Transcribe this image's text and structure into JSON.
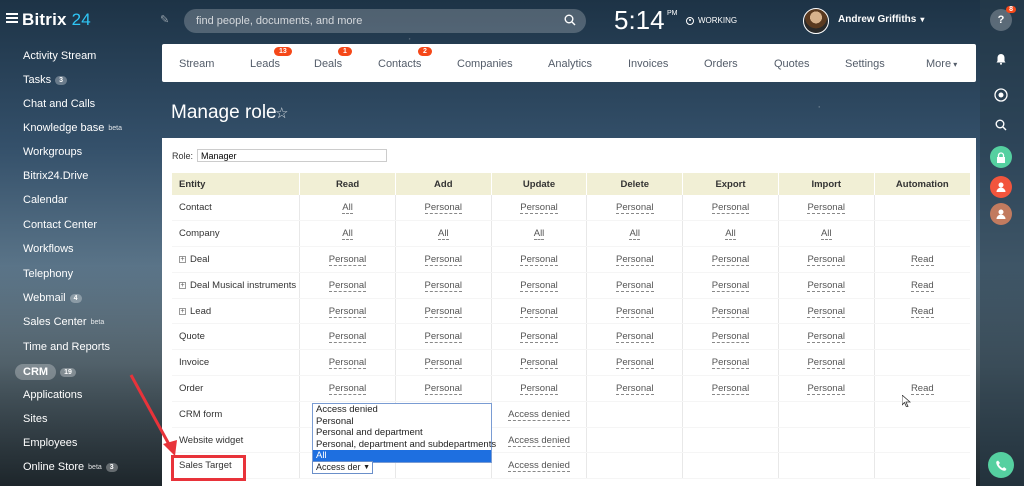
{
  "header": {
    "logo_main": "Bitrix",
    "logo_num": "24",
    "search_placeholder": "find people, documents, and more",
    "time": "5:14",
    "ampm": "PM",
    "status": "WORKING",
    "user": "Andrew Griffiths",
    "help_badge": "8"
  },
  "left_menu": [
    {
      "label": "Activity Stream"
    },
    {
      "label": "Tasks",
      "count": "3"
    },
    {
      "label": "Chat and Calls"
    },
    {
      "label": "Knowledge base",
      "sup": "beta"
    },
    {
      "label": "Workgroups"
    },
    {
      "label": "Bitrix24.Drive"
    },
    {
      "label": "Calendar"
    },
    {
      "label": "Contact Center"
    },
    {
      "label": "Workflows"
    },
    {
      "label": "Telephony"
    },
    {
      "label": "Webmail",
      "count": "4"
    },
    {
      "label": "Sales Center",
      "sup": "beta"
    },
    {
      "label": "Time and Reports"
    },
    {
      "label": "CRM",
      "count": "19",
      "active": true
    },
    {
      "label": "Applications"
    },
    {
      "label": "Sites"
    },
    {
      "label": "Employees"
    },
    {
      "label": "Online Store",
      "sup": "beta",
      "count": "3"
    }
  ],
  "crm_tabs": [
    {
      "label": "Stream"
    },
    {
      "label": "Leads",
      "badge": "13"
    },
    {
      "label": "Deals",
      "badge": "1"
    },
    {
      "label": "Contacts",
      "badge": "2"
    },
    {
      "label": "Companies"
    },
    {
      "label": "Analytics"
    },
    {
      "label": "Invoices"
    },
    {
      "label": "Orders"
    },
    {
      "label": "Quotes"
    },
    {
      "label": "Settings"
    },
    {
      "label": "More"
    }
  ],
  "page_title": "Manage role",
  "role": {
    "label": "Role:",
    "value": "Manager"
  },
  "table": {
    "headers": [
      "Entity",
      "Read",
      "Add",
      "Update",
      "Delete",
      "Export",
      "Import",
      "Automation"
    ],
    "rows": [
      {
        "entity": "Contact",
        "expand": false,
        "cells": [
          "All",
          "Personal",
          "Personal",
          "Personal",
          "Personal",
          "Personal",
          ""
        ]
      },
      {
        "entity": "Company",
        "expand": false,
        "cells": [
          "All",
          "All",
          "All",
          "All",
          "All",
          "All",
          ""
        ]
      },
      {
        "entity": "Deal",
        "expand": true,
        "cells": [
          "Personal",
          "Personal",
          "Personal",
          "Personal",
          "Personal",
          "Personal",
          "Read"
        ]
      },
      {
        "entity": "Deal Musical instruments",
        "expand": true,
        "cells": [
          "Personal",
          "Personal",
          "Personal",
          "Personal",
          "Personal",
          "Personal",
          "Read"
        ]
      },
      {
        "entity": "Lead",
        "expand": true,
        "cells": [
          "Personal",
          "Personal",
          "Personal",
          "Personal",
          "Personal",
          "Personal",
          "Read"
        ]
      },
      {
        "entity": "Quote",
        "expand": false,
        "cells": [
          "Personal",
          "Personal",
          "Personal",
          "Personal",
          "Personal",
          "Personal",
          ""
        ]
      },
      {
        "entity": "Invoice",
        "expand": false,
        "cells": [
          "Personal",
          "Personal",
          "Personal",
          "Personal",
          "Personal",
          "Personal",
          ""
        ]
      },
      {
        "entity": "Order",
        "expand": false,
        "cells": [
          "Personal",
          "Personal",
          "Personal",
          "Personal",
          "Personal",
          "Personal",
          "Read"
        ]
      },
      {
        "entity": "CRM form",
        "expand": false,
        "cells": [
          "",
          "",
          "Access denied",
          "",
          "",
          "",
          ""
        ]
      },
      {
        "entity": "Website widget",
        "expand": false,
        "cells": [
          "",
          "",
          "Access denied",
          "",
          "",
          "",
          ""
        ]
      },
      {
        "entity": "Sales Target",
        "expand": false,
        "cells": [
          "",
          "",
          "Access denied",
          "",
          "",
          "",
          ""
        ]
      }
    ]
  },
  "dropdown": {
    "options": [
      "Access denied",
      "Personal",
      "Personal and department",
      "Personal, department and subdepartments",
      "All"
    ],
    "selected_index": 4,
    "current_value": "Access der"
  },
  "colors": {
    "accent": "#2fc6f6",
    "badge": "#f54819",
    "highlight": "#e8333a",
    "table_header": "#f1efd5"
  }
}
